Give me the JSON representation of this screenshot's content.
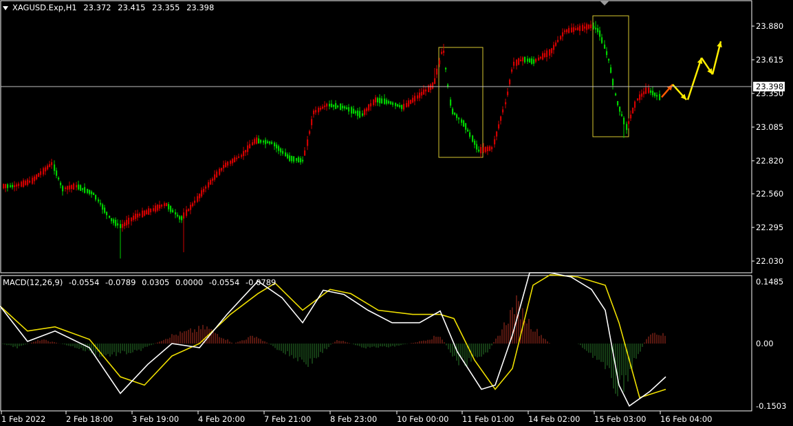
{
  "header": {
    "symbol": "XAGUSD.Exp,H1",
    "open": "23.372",
    "high": "23.415",
    "low": "23.355",
    "close": "23.398"
  },
  "macd_header": {
    "name": "MACD(12,26,9)",
    "values": [
      "-0.0554",
      "-0.0789",
      "0.0305",
      "0.0000",
      "-0.0554",
      "-0.0789"
    ]
  },
  "price_axis": {
    "ticks": [
      "23.880",
      "23.615",
      "23.350",
      "23.085",
      "22.820",
      "22.560",
      "22.295",
      "22.030"
    ],
    "current_price_label": "23.398"
  },
  "macd_axis": {
    "ticks": [
      "0.1485",
      "0.00",
      "-0.1503"
    ]
  },
  "time_axis": {
    "ticks": [
      "1 Feb 2022",
      "2 Feb 18:00",
      "3 Feb 19:00",
      "4 Feb 20:00",
      "7 Feb 21:00",
      "8 Feb 23:00",
      "10 Feb 00:00",
      "11 Feb 01:00",
      "14 Feb 02:00",
      "15 Feb 03:00",
      "16 Feb 04:00"
    ]
  },
  "colors": {
    "background": "#000000",
    "bull": "#00d000",
    "bear": "#d00000",
    "macd_line": "#ffffff",
    "signal_line": "#f0e000",
    "hist_pos": "#b03020",
    "hist_neg": "#2a7a2a",
    "box": "#d8c830",
    "arrow": "#ffee00",
    "grid_line": "#c0c0c0"
  },
  "chart_data": {
    "type": "candlestick",
    "symbol": "XAGUSD.Exp",
    "timeframe": "H1",
    "ylim": [
      22.0,
      24.1
    ],
    "current_price": 23.398,
    "price_path": [
      [
        0,
        22.62
      ],
      [
        20,
        22.62
      ],
      [
        45,
        22.66
      ],
      [
        75,
        22.8
      ],
      [
        90,
        22.6
      ],
      [
        110,
        22.62
      ],
      [
        135,
        22.56
      ],
      [
        160,
        22.36
      ],
      [
        175,
        22.3
      ],
      [
        195,
        22.38
      ],
      [
        215,
        22.42
      ],
      [
        240,
        22.48
      ],
      [
        262,
        22.36
      ],
      [
        280,
        22.48
      ],
      [
        300,
        22.62
      ],
      [
        325,
        22.78
      ],
      [
        350,
        22.86
      ],
      [
        370,
        22.98
      ],
      [
        395,
        22.96
      ],
      [
        420,
        22.84
      ],
      [
        440,
        22.82
      ],
      [
        455,
        23.2
      ],
      [
        475,
        23.26
      ],
      [
        500,
        23.24
      ],
      [
        525,
        23.18
      ],
      [
        545,
        23.3
      ],
      [
        565,
        23.28
      ],
      [
        585,
        23.24
      ],
      [
        610,
        23.34
      ],
      [
        630,
        23.42
      ],
      [
        643,
        23.72
      ],
      [
        655,
        23.22
      ],
      [
        675,
        23.1
      ],
      [
        695,
        22.9
      ],
      [
        715,
        22.92
      ],
      [
        735,
        23.3
      ],
      [
        745,
        23.58
      ],
      [
        760,
        23.62
      ],
      [
        775,
        23.6
      ],
      [
        800,
        23.68
      ],
      [
        820,
        23.84
      ],
      [
        840,
        23.86
      ],
      [
        860,
        23.88
      ],
      [
        870,
        23.84
      ],
      [
        885,
        23.6
      ],
      [
        895,
        23.3
      ],
      [
        910,
        23.08
      ],
      [
        925,
        23.3
      ],
      [
        940,
        23.38
      ],
      [
        958,
        23.32
      ]
    ],
    "highlight_boxes": [
      {
        "from": "10 Feb 00:00",
        "to": "11 Feb 01:00"
      },
      {
        "from": "15 Feb 03:00",
        "to": "16 Feb 04:00"
      }
    ],
    "forecast_arrows": [
      [
        23.32,
        23.42
      ],
      [
        23.42,
        23.3
      ],
      [
        23.3,
        23.63
      ],
      [
        23.63,
        23.5
      ],
      [
        23.5,
        23.76
      ]
    ],
    "macd": {
      "name": "MACD(12,26,9)",
      "ylim": [
        -0.1503,
        0.1485
      ],
      "macd_path": [
        [
          0,
          0.09
        ],
        [
          40,
          0.005
        ],
        [
          80,
          0.03
        ],
        [
          130,
          -0.01
        ],
        [
          175,
          -0.12
        ],
        [
          215,
          -0.05
        ],
        [
          250,
          0.0
        ],
        [
          290,
          -0.01
        ],
        [
          330,
          0.07
        ],
        [
          375,
          0.15
        ],
        [
          410,
          0.11
        ],
        [
          440,
          0.05
        ],
        [
          470,
          0.128
        ],
        [
          500,
          0.118
        ],
        [
          535,
          0.08
        ],
        [
          570,
          0.05
        ],
        [
          610,
          0.05
        ],
        [
          640,
          0.078
        ],
        [
          665,
          -0.02
        ],
        [
          700,
          -0.11
        ],
        [
          720,
          -0.1
        ],
        [
          745,
          0.02
        ],
        [
          770,
          0.17
        ],
        [
          800,
          0.17
        ],
        [
          830,
          0.16
        ],
        [
          860,
          0.13
        ],
        [
          880,
          0.08
        ],
        [
          900,
          -0.1
        ],
        [
          915,
          -0.15
        ],
        [
          945,
          -0.115
        ],
        [
          968,
          -0.08
        ]
      ],
      "signal_path": [
        [
          0,
          0.09
        ],
        [
          40,
          0.03
        ],
        [
          80,
          0.04
        ],
        [
          130,
          0.01
        ],
        [
          175,
          -0.08
        ],
        [
          210,
          -0.1
        ],
        [
          250,
          -0.03
        ],
        [
          290,
          0.0
        ],
        [
          335,
          0.07
        ],
        [
          375,
          0.12
        ],
        [
          400,
          0.145
        ],
        [
          440,
          0.08
        ],
        [
          480,
          0.13
        ],
        [
          510,
          0.12
        ],
        [
          550,
          0.08
        ],
        [
          600,
          0.07
        ],
        [
          640,
          0.07
        ],
        [
          660,
          0.06
        ],
        [
          690,
          -0.04
        ],
        [
          720,
          -0.11
        ],
        [
          745,
          -0.06
        ],
        [
          775,
          0.14
        ],
        [
          800,
          0.165
        ],
        [
          840,
          0.16
        ],
        [
          880,
          0.14
        ],
        [
          900,
          0.05
        ],
        [
          930,
          -0.13
        ],
        [
          968,
          -0.11
        ]
      ],
      "histogram_segments": [
        [
          0,
          0.0
        ],
        [
          25,
          -0.01
        ],
        [
          60,
          0.01
        ],
        [
          100,
          -0.005
        ],
        [
          150,
          -0.03
        ],
        [
          200,
          -0.02
        ],
        [
          250,
          0.02
        ],
        [
          300,
          0.04
        ],
        [
          340,
          0.0
        ],
        [
          370,
          0.02
        ],
        [
          410,
          -0.02
        ],
        [
          450,
          -0.05
        ],
        [
          490,
          0.01
        ],
        [
          530,
          -0.01
        ],
        [
          570,
          -0.008
        ],
        [
          610,
          0.005
        ],
        [
          640,
          0.02
        ],
        [
          665,
          -0.05
        ],
        [
          700,
          -0.04
        ],
        [
          725,
          0.02
        ],
        [
          750,
          0.1
        ],
        [
          775,
          0.04
        ],
        [
          800,
          0.0
        ],
        [
          840,
          0.0
        ],
        [
          870,
          -0.04
        ],
        [
          900,
          -0.12
        ],
        [
          925,
          -0.04
        ],
        [
          945,
          0.03
        ],
        [
          968,
          0.02
        ]
      ]
    }
  }
}
